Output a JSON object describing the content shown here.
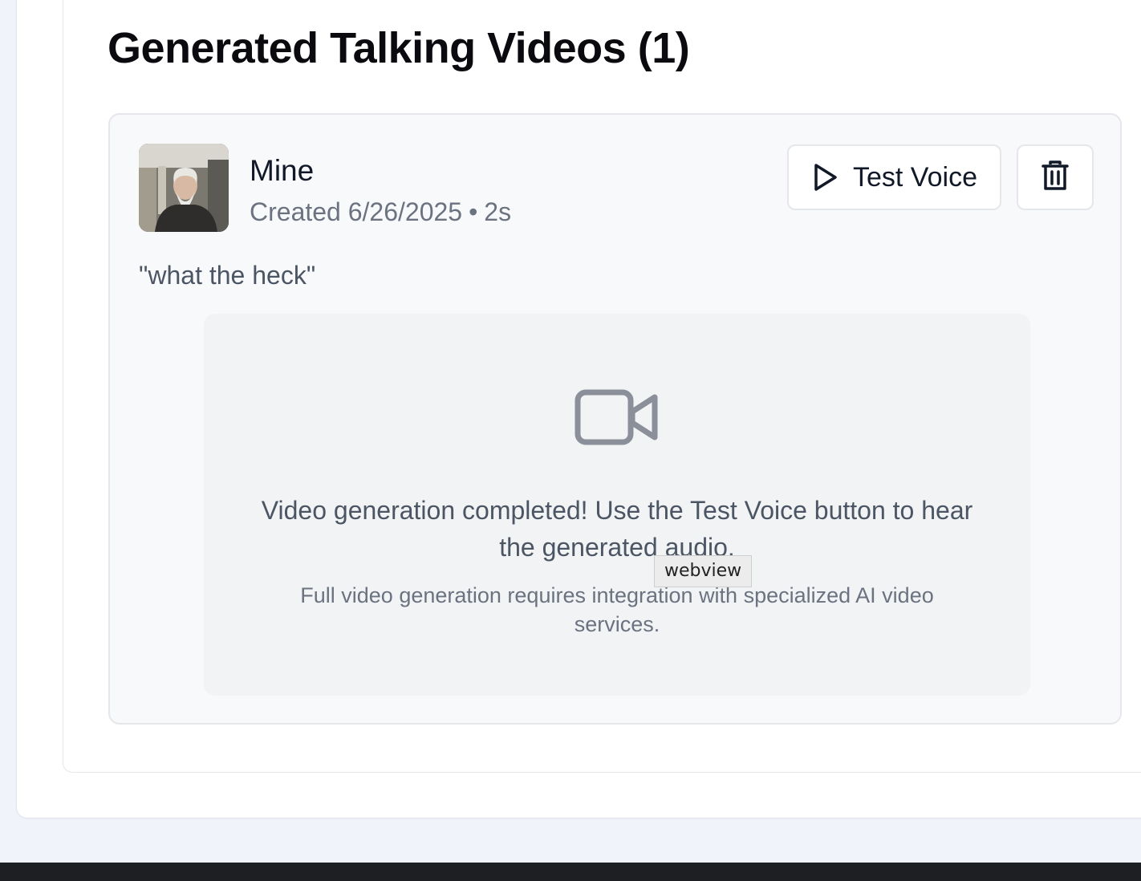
{
  "section": {
    "title": "Generated Talking Videos (1)"
  },
  "video": {
    "name": "Mine",
    "created_label": "Created 6/26/2025",
    "separator": "•",
    "duration": "2s",
    "quote": "\"what the heck\"",
    "test_voice_label": "Test Voice",
    "placeholder_message": "Video generation completed! Use the Test Voice button to hear the generated audio.",
    "placeholder_note": "Full video generation requires integration with specialized AI video services."
  },
  "tooltip": {
    "text": "webview"
  },
  "icons": {
    "play": "play-icon",
    "delete": "trash-icon",
    "video": "video-camera-icon",
    "avatar": "avatar-thumbnail"
  },
  "colors": {
    "title": "#0b0b0f",
    "muted": "#6b7280",
    "card_bg": "#f8f9fb",
    "placeholder_bg": "#f2f3f5",
    "icon_gray": "#8a8f99"
  }
}
